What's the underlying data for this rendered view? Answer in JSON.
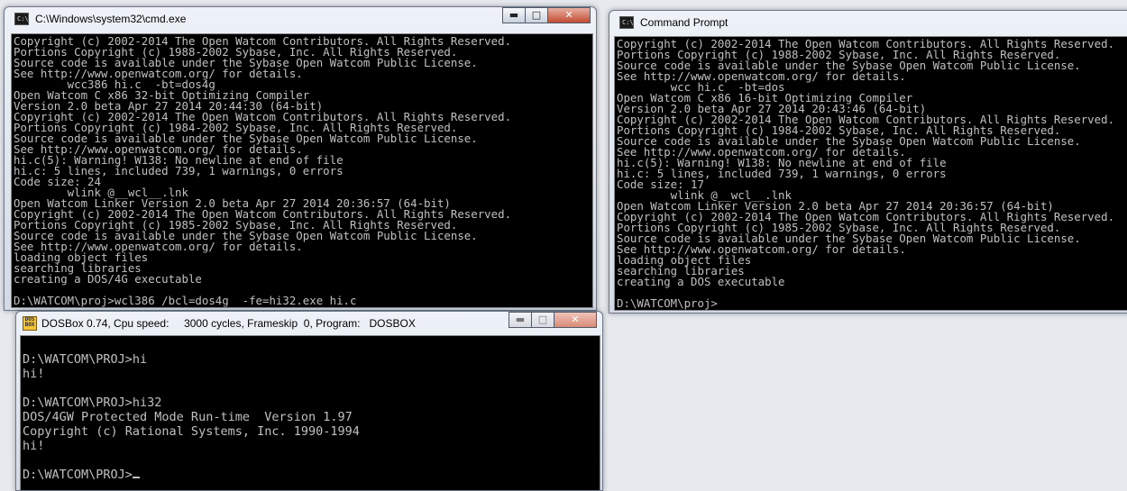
{
  "cmd_window": {
    "title": "C:\\Windows\\system32\\cmd.exe",
    "controls": {
      "minimize": "▬",
      "maximize": "□",
      "close": "✕"
    },
    "lines": [
      "Copyright (c) 2002-2014 The Open Watcom Contributors. All Rights Reserved.",
      "Portions Copyright (c) 1988-2002 Sybase, Inc. All Rights Reserved.",
      "Source code is available under the Sybase Open Watcom Public License.",
      "See http://www.openwatcom.org/ for details.",
      "        wcc386 hi.c  -bt=dos4g",
      "Open Watcom C x86 32-bit Optimizing Compiler",
      "Version 2.0 beta Apr 27 2014 20:44:30 (64-bit)",
      "Copyright (c) 2002-2014 The Open Watcom Contributors. All Rights Reserved.",
      "Portions Copyright (c) 1984-2002 Sybase, Inc. All Rights Reserved.",
      "Source code is available under the Sybase Open Watcom Public License.",
      "See http://www.openwatcom.org/ for details.",
      "hi.c(5): Warning! W138: No newline at end of file",
      "hi.c: 5 lines, included 739, 1 warnings, 0 errors",
      "Code size: 24",
      "        wlink @__wcl__.lnk",
      "Open Watcom Linker Version 2.0 beta Apr 27 2014 20:36:57 (64-bit)",
      "Copyright (c) 2002-2014 The Open Watcom Contributors. All Rights Reserved.",
      "Portions Copyright (c) 1985-2002 Sybase, Inc. All Rights Reserved.",
      "Source code is available under the Sybase Open Watcom Public License.",
      "See http://www.openwatcom.org/ for details.",
      "loading object files",
      "searching libraries",
      "creating a DOS/4G executable",
      "",
      "D:\\WATCOM\\proj>wcl386 /bcl=dos4g  -fe=hi32.exe hi.c"
    ]
  },
  "cp_window": {
    "title": "Command Prompt",
    "lines": [
      "Copyright (c) 2002-2014 The Open Watcom Contributors. All Rights Reserved.",
      "Portions Copyright (c) 1988-2002 Sybase, Inc. All Rights Reserved.",
      "Source code is available under the Sybase Open Watcom Public License.",
      "See http://www.openwatcom.org/ for details.",
      "        wcc hi.c  -bt=dos",
      "Open Watcom C x86 16-bit Optimizing Compiler",
      "Version 2.0 beta Apr 27 2014 20:43:46 (64-bit)",
      "Copyright (c) 2002-2014 The Open Watcom Contributors. All Rights Reserved.",
      "Portions Copyright (c) 1984-2002 Sybase, Inc. All Rights Reserved.",
      "Source code is available under the Sybase Open Watcom Public License.",
      "See http://www.openwatcom.org/ for details.",
      "hi.c(5): Warning! W138: No newline at end of file",
      "hi.c: 5 lines, included 739, 1 warnings, 0 errors",
      "Code size: 17",
      "        wlink @__wcl__.lnk",
      "Open Watcom Linker Version 2.0 beta Apr 27 2014 20:36:57 (64-bit)",
      "Copyright (c) 2002-2014 The Open Watcom Contributors. All Rights Reserved.",
      "Portions Copyright (c) 1985-2002 Sybase, Inc. All Rights Reserved.",
      "Source code is available under the Sybase Open Watcom Public License.",
      "See http://www.openwatcom.org/ for details.",
      "loading object files",
      "searching libraries",
      "creating a DOS executable",
      "",
      "D:\\WATCOM\\proj>"
    ]
  },
  "dosbox_window": {
    "title": "DOSBox 0.74, Cpu speed:     3000 cycles, Frameskip  0, Program:   DOSBOX",
    "icon_text": "DOS BOX",
    "lines": [
      "",
      "D:\\WATCOM\\PROJ>hi",
      "hi!",
      "",
      "D:\\WATCOM\\PROJ>hi32",
      "DOS/4GW Protected Mode Run-time  Version 1.97",
      "Copyright (c) Rational Systems, Inc. 1990-1994",
      "hi!",
      "",
      "D:\\WATCOM\\PROJ>"
    ]
  },
  "colors": {
    "console_bg": "#000000",
    "console_text": "#c0c0c0",
    "close_button": "#c24a31"
  }
}
